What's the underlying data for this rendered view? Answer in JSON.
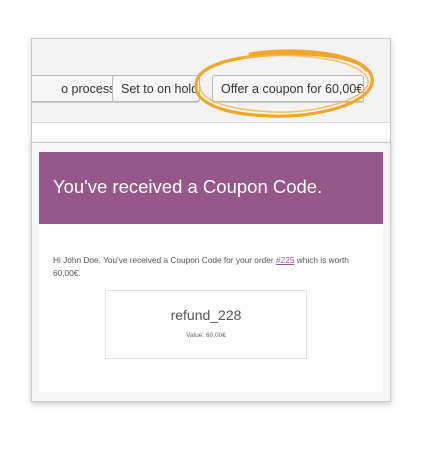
{
  "toolbar": {
    "processing_label": "o processing",
    "on_hold_label": "Set to on hold",
    "offer_coupon_label": "Offer a coupon for 60,00€"
  },
  "email": {
    "header_title": "You've received a Coupon Code.",
    "greeting_before_link": "Hi John Doe. You've received a Coupon Code for your order ",
    "order_link": "#225",
    "greeting_after_link": " which is worth 60,00€.",
    "coupon_code": "refund_228",
    "coupon_value": "Value: 60,00€"
  },
  "colors": {
    "header_purple": "#96588a",
    "highlight_orange": "#f2a62c"
  },
  "icons": {
    "highlight": "hand-drawn-circle"
  }
}
